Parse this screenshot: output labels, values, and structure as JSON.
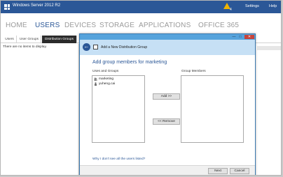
{
  "window": {
    "title": "Windows Server 2012 R2"
  },
  "topbar": {
    "settings": "Settings",
    "help": "Help",
    "notification_count": "4",
    "notification_icon": "warning-flag-icon"
  },
  "nav": {
    "items": [
      "HOME",
      "USERS",
      "DEVICES",
      "STORAGE",
      "APPLICATIONS",
      "OFFICE 365"
    ],
    "active": "USERS"
  },
  "tabs": {
    "items": [
      "Users",
      "User Groups",
      "Distribution Groups"
    ],
    "active": "Distribution Groups"
  },
  "main": {
    "empty_message": "There are no items to display."
  },
  "dialog": {
    "title": "Add a New Distribution Group",
    "heading": "Add group members for marketing",
    "left_label": "Uses and Groups",
    "right_label": "Group Members",
    "available": [
      {
        "name": "marketing",
        "icon": "group-icon"
      },
      {
        "name": "yuheng.cai",
        "icon": "user-icon"
      }
    ],
    "add_label": "Add >>",
    "remove_label": "<< Remove",
    "link": "Why I don't see all the users listed?",
    "next_label": "Next",
    "cancel_label": "Cancel",
    "min_glyph": "—",
    "max_glyph": "□",
    "close_glyph": "✕",
    "back_glyph": "←"
  },
  "colors": {
    "accent": "#2b5797",
    "titlebar": "#56a3dc",
    "header": "#c6e0f5",
    "close": "#c7443b"
  }
}
